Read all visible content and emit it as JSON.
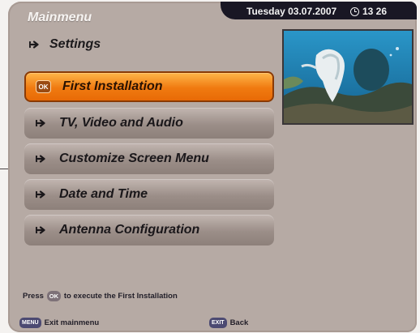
{
  "header": {
    "date": "Tuesday 03.07.2007",
    "time": "13 26",
    "title": "Mainmenu"
  },
  "section": {
    "label": "Settings",
    "icon": "arrow-icon"
  },
  "menu": {
    "items": [
      {
        "label": "First Installation",
        "icon": "ok-badge",
        "icon_text": "OK"
      },
      {
        "label": "TV, Video and Audio",
        "icon": "arrow-icon"
      },
      {
        "label": "Customize Screen Menu",
        "icon": "arrow-icon"
      },
      {
        "label": "Date and Time",
        "icon": "arrow-icon"
      },
      {
        "label": "Antenna Configuration",
        "icon": "arrow-icon"
      }
    ],
    "selected_index": 0
  },
  "hint": {
    "prefix": "Press",
    "key": "OK",
    "suffix": "to execute the First Installation"
  },
  "footer": {
    "menu_key": "MENU",
    "menu_label": "Exit mainmenu",
    "exit_key": "EXIT",
    "exit_label": "Back"
  },
  "preview": {
    "icon": "underwater-preview-image"
  },
  "colors": {
    "panel": "#b6aaa4",
    "highlight": "#f07a10",
    "topbar": "#191724"
  }
}
